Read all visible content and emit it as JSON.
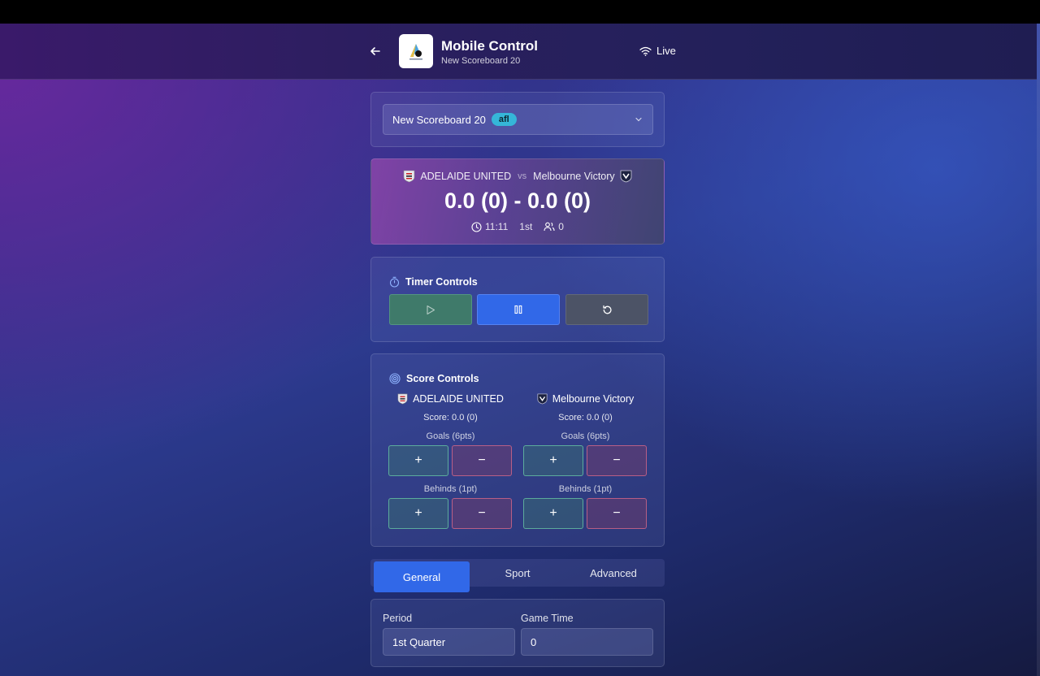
{
  "header": {
    "title": "Mobile Control",
    "subtitle": "New Scoreboard 20",
    "status": "Live"
  },
  "selector": {
    "value": "New Scoreboard 20",
    "badge": "afl"
  },
  "match": {
    "home_team": "ADELAIDE UNITED",
    "vs": "vs",
    "away_team": "Melbourne Victory",
    "score": "0.0 (0) - 0.0 (0)",
    "time": "11:11",
    "period": "1st",
    "attendance": "0"
  },
  "timer": {
    "title": "Timer Controls"
  },
  "score_controls": {
    "title": "Score Controls",
    "teams": [
      {
        "name": "ADELAIDE UNITED",
        "score": "Score: 0.0 (0)",
        "goals_label": "Goals (6pts)",
        "behinds_label": "Behinds (1pt)",
        "plus": "+",
        "minus": "−"
      },
      {
        "name": "Melbourne Victory",
        "score": "Score: 0.0 (0)",
        "goals_label": "Goals (6pts)",
        "behinds_label": "Behinds (1pt)",
        "plus": "+",
        "minus": "−"
      }
    ]
  },
  "tabs": [
    {
      "label": "General",
      "active": true
    },
    {
      "label": "Sport",
      "active": false
    },
    {
      "label": "Advanced",
      "active": false
    }
  ],
  "general": {
    "period_label": "Period",
    "period_value": "1st Quarter",
    "game_time_label": "Game Time",
    "game_time_value": "0"
  },
  "colors": {
    "accent": "#3168e8",
    "badge": "#35b6d8",
    "plus_border": "#6ed2aa",
    "minus_border": "#e66e8c"
  }
}
